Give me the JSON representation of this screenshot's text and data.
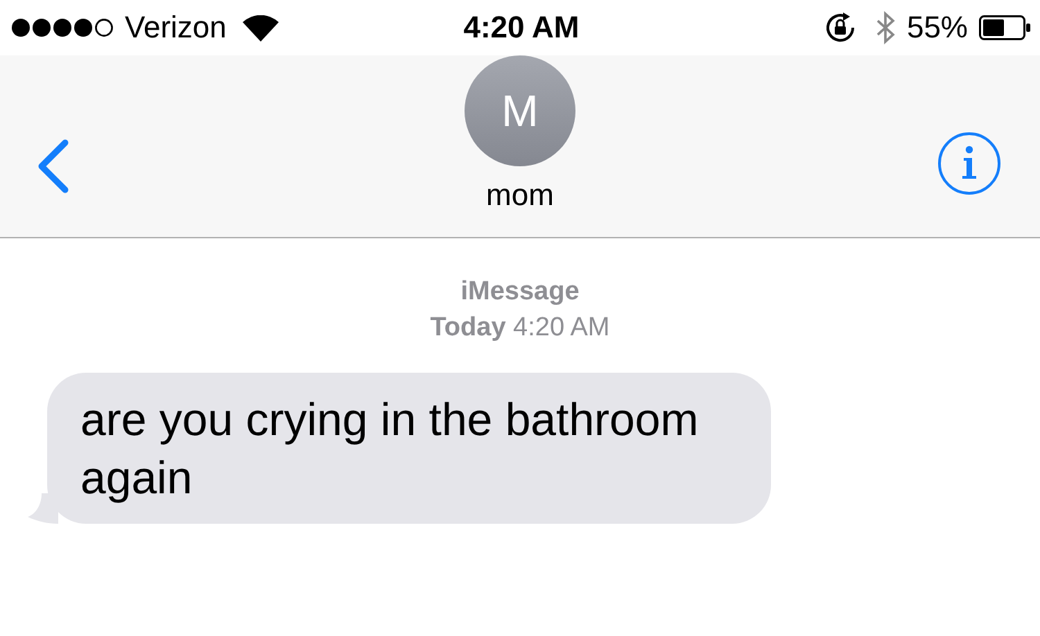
{
  "status_bar": {
    "carrier": "Verizon",
    "time": "4:20 AM",
    "battery": "55%"
  },
  "header": {
    "avatar_initial": "M",
    "contact_name": "mom"
  },
  "conversation": {
    "service": "iMessage",
    "timestamp": "**Today** 4:20 AM",
    "messages": [
      {
        "kind": "received",
        "text": "are you crying in the bathroom again"
      }
    ]
  }
}
